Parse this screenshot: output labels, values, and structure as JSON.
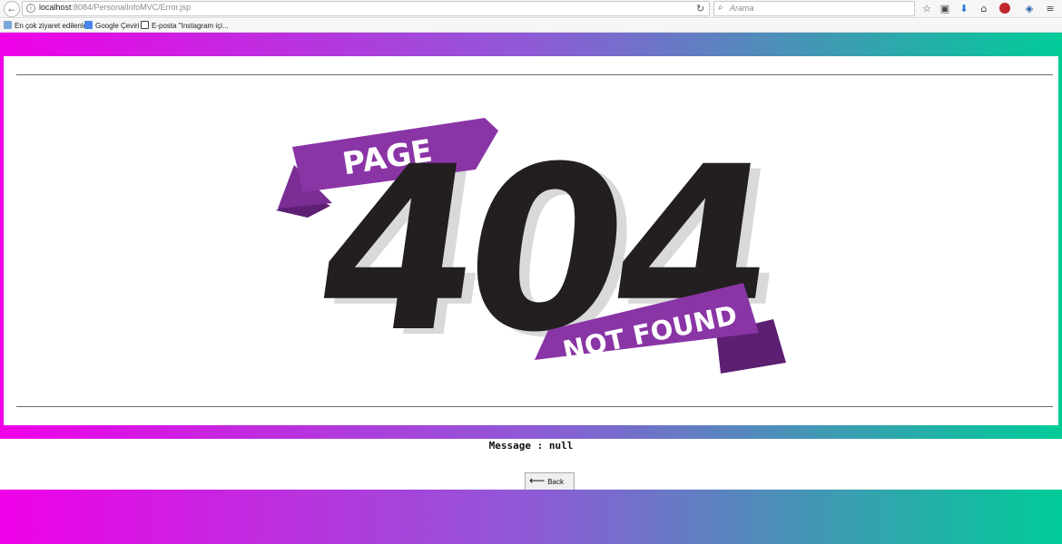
{
  "browser": {
    "url_host": "localhost",
    "url_path": ":8084/PersonalInfoMVC/Error.jsp",
    "search_placeholder": "Arama",
    "bookmarks": [
      {
        "label": "En çok ziyaret edilenler"
      },
      {
        "label": "Google Çeviri"
      },
      {
        "label": "E-posta \"Instagram içi..."
      }
    ]
  },
  "banner": {
    "ribbon_top": "PAGE",
    "code": "404",
    "ribbon_bottom": "NOT FOUND"
  },
  "message": {
    "text": "Message : null"
  },
  "back_button": {
    "label": "Back"
  },
  "colors": {
    "gradient_start": "#f000e8",
    "gradient_mid": "#8e5ad6",
    "gradient_end": "#00cc98",
    "ribbon": "#8a35a6",
    "ribbon_dark": "#5d1f72",
    "digits": "#231f20"
  }
}
